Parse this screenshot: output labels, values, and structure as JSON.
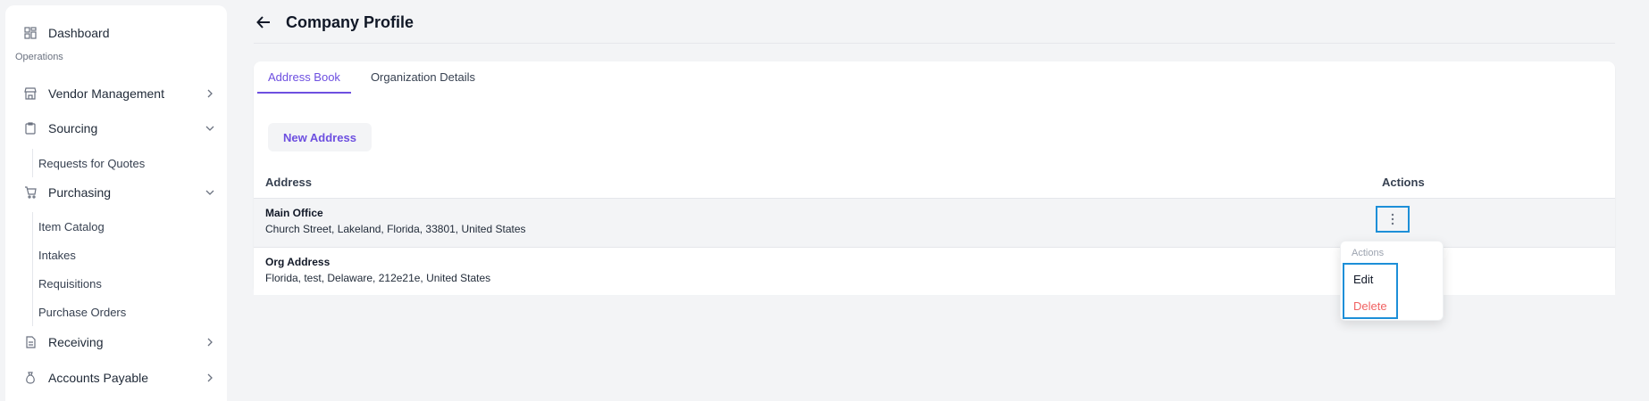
{
  "sidebar": {
    "dashboard": "Dashboard",
    "section_operations": "Operations",
    "vendor_management": "Vendor Management",
    "sourcing": "Sourcing",
    "sourcing_items": [
      "Requests for Quotes"
    ],
    "purchasing": "Purchasing",
    "purchasing_items": [
      "Item Catalog",
      "Intakes",
      "Requisitions",
      "Purchase Orders"
    ],
    "receiving": "Receiving",
    "accounts_payable": "Accounts Payable"
  },
  "header": {
    "title": "Company Profile"
  },
  "tabs": {
    "address_book": "Address Book",
    "organization_details": "Organization Details"
  },
  "actions": {
    "new_address": "New Address"
  },
  "table": {
    "col_address": "Address",
    "col_actions": "Actions",
    "rows": [
      {
        "name": "Main Office",
        "address": "Church Street, Lakeland, Florida, 33801, United States"
      },
      {
        "name": "Org Address",
        "address": "Florida, test, Delaware, 212e21e, United States"
      }
    ]
  },
  "dropdown": {
    "header": "Actions",
    "edit": "Edit",
    "delete": "Delete"
  },
  "colors": {
    "accent": "#6d4fe0",
    "focus_outline": "#1d8fd8",
    "danger": "#f06262"
  }
}
